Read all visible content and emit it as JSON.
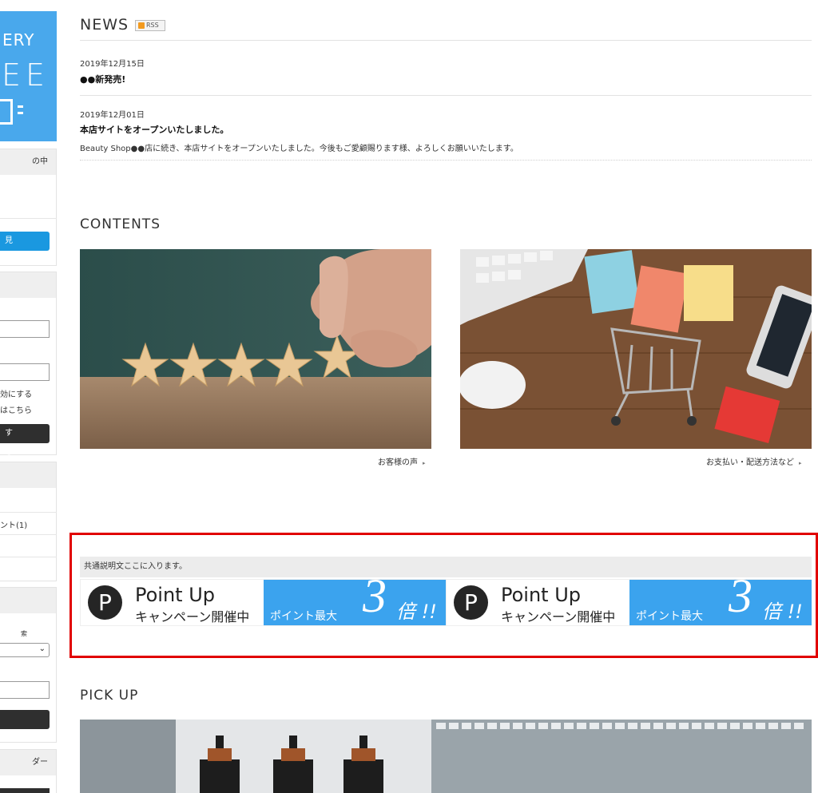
{
  "sidebar": {
    "logo": {
      "line1": "ERY",
      "line2": "EE"
    },
    "cart_heading": "の中",
    "cart_button": "見る",
    "login_remember": "効にする",
    "login_forgot": "はこちら",
    "login_button": "する",
    "category_item": "ント(1)",
    "search_heading_text": "索",
    "calendar_heading": "ダー"
  },
  "news": {
    "title": "NEWS",
    "rss_label": "RSS",
    "items": [
      {
        "date": "2019年12月15日",
        "title": "●●新発売!",
        "body": ""
      },
      {
        "date": "2019年12月01日",
        "title": "本店サイトをオープンいたしました。",
        "body": "Beauty Shop●●店に続き、本店サイトをオープンいたしました。今後もご愛顧賜ります様、よろしくお願いいたします。"
      }
    ]
  },
  "contents": {
    "title": "CONTENTS",
    "items": [
      {
        "caption": "お客様の声"
      },
      {
        "caption": "お支払い・配送方法など"
      }
    ],
    "arrow_glyph": "▸"
  },
  "banner": {
    "description": "共通説明文ここに入ります。",
    "p_letter": "P",
    "headline": "Point Up",
    "subline": "キャンペーン開催中",
    "point_max": "ポイント最大",
    "multiplier": "3",
    "times": "倍 !!"
  },
  "pickup": {
    "title": "PICK UP"
  },
  "colors": {
    "logo_blue": "#49a8ec",
    "banner_blue": "#3ba3ee",
    "highlight_red": "#e10000",
    "button_blue": "#1a98e0",
    "button_dark": "#2f2f2f"
  }
}
